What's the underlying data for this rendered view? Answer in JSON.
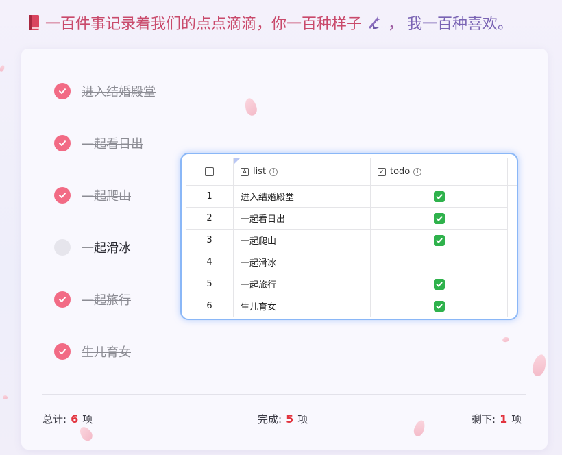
{
  "header": {
    "part1": "一百件事记录着我们的点点滴滴，你一百种样子",
    "part2": "，",
    "part3": "我一百种喜欢。"
  },
  "todos": [
    {
      "label": "进入结婚殿堂",
      "done": true
    },
    {
      "label": "一起看日出",
      "done": true
    },
    {
      "label": "一起爬山",
      "done": true
    },
    {
      "label": "一起滑冰",
      "done": false
    },
    {
      "label": "一起旅行",
      "done": true
    },
    {
      "label": "生儿育女",
      "done": true
    }
  ],
  "stats": {
    "total_label": "总计:",
    "total_value": "6",
    "done_label": "完成:",
    "done_value": "5",
    "left_label": "剩下:",
    "left_value": "1",
    "unit": "项"
  },
  "table": {
    "col_list": "list",
    "col_todo": "todo",
    "rows": [
      {
        "n": "1",
        "list": "进入结婚殿堂",
        "todo": true
      },
      {
        "n": "2",
        "list": "一起看日出",
        "todo": true
      },
      {
        "n": "3",
        "list": "一起爬山",
        "todo": true
      },
      {
        "n": "4",
        "list": "一起滑冰",
        "todo": false
      },
      {
        "n": "5",
        "list": "一起旅行",
        "todo": true
      },
      {
        "n": "6",
        "list": "生儿育女",
        "todo": true
      }
    ]
  },
  "colors": {
    "accent": "#f26b85",
    "stat_number": "#e2343f",
    "table_border": "#8ab7f7"
  }
}
